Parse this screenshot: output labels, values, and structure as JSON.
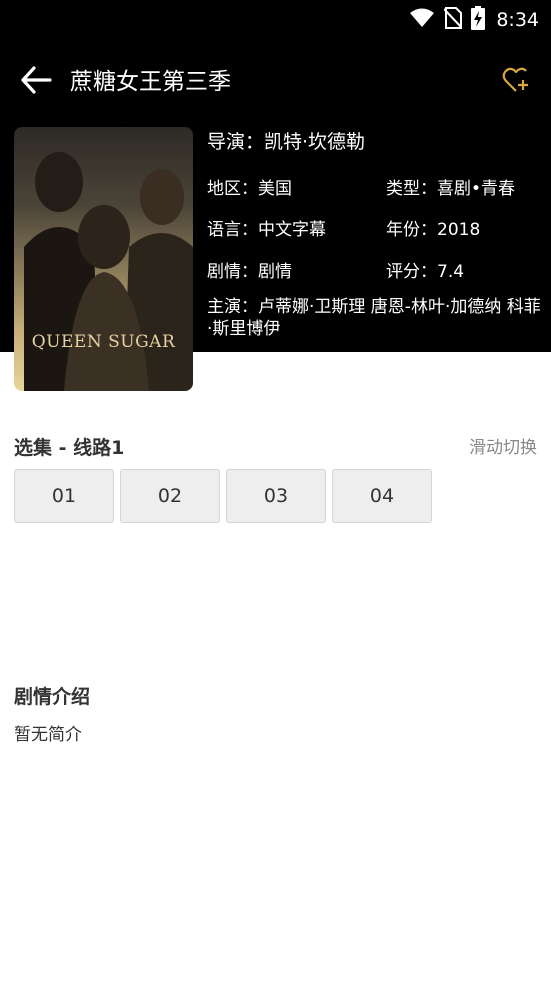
{
  "status_bar": {
    "time": "8:34",
    "icons": [
      "wifi-icon",
      "no-sim-icon",
      "battery-charging-icon"
    ]
  },
  "header": {
    "title": "蔗糖女王第三季",
    "back_icon": "back-arrow-icon",
    "favorite_icon": "heart-plus-icon"
  },
  "poster": {
    "text": "QUEEN SUGAR"
  },
  "info": {
    "director": "导演：凯特·坎德勒",
    "region": "地区：美国",
    "genre": "类型：喜剧•青春",
    "language": "语言：中文字幕",
    "year": "年份：2018",
    "plot": "剧情：剧情",
    "rating": "评分：7.4",
    "cast": "主演：卢蒂娜·卫斯理  唐恩-林叶·加德纳  科菲·斯里博伊"
  },
  "episodes_section": {
    "title": "选集 - 线路1",
    "hint": "滑动切换",
    "episodes": [
      "01",
      "02",
      "03",
      "04"
    ]
  },
  "synopsis_section": {
    "title": "剧情介绍",
    "text": "暂无简介"
  },
  "colors": {
    "header_bg": "#000000",
    "accent": "#d9a640",
    "episode_bg": "#eeeeee"
  }
}
